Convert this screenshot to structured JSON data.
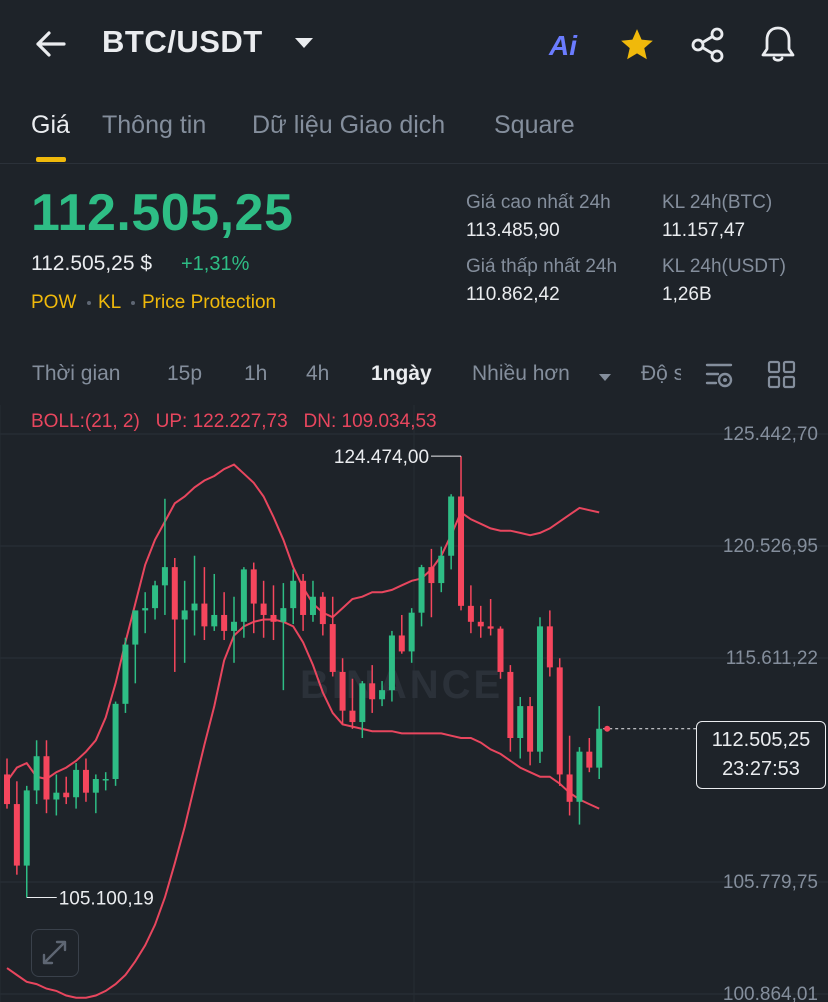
{
  "header": {
    "pair": "BTC/USDT",
    "ai_label": "Ai",
    "icons": [
      "back-arrow-icon",
      "chevron-down-icon",
      "ai-icon",
      "star-icon",
      "share-icon",
      "bell-icon"
    ]
  },
  "tabs": [
    {
      "label": "Giá",
      "active": true
    },
    {
      "label": "Thông tin",
      "active": false
    },
    {
      "label": "Dữ liệu Giao dịch",
      "active": false
    },
    {
      "label": "Square",
      "active": false
    }
  ],
  "price": {
    "last": "112.505,25",
    "usd": "112.505,25 $",
    "change": "+1,31%",
    "tags": [
      "POW",
      "KL",
      "Price Protection"
    ]
  },
  "stats": {
    "high_label": "Giá cao nhất 24h",
    "high_value": "113.485,90",
    "low_label": "Giá thấp nhất 24h",
    "low_value": "110.862,42",
    "vol_btc_label": "KL 24h(BTC)",
    "vol_btc_value": "11.157,47",
    "vol_usdt_label": "KL 24h(USDT)",
    "vol_usdt_value": "1,26B"
  },
  "intervals": {
    "label": "Thời gian",
    "items": [
      "15p",
      "1h",
      "4h",
      "1ngày"
    ],
    "active": "1ngày",
    "more": "Nhiều hơn",
    "depth": "Độ s"
  },
  "boll": {
    "text": "BOLL:(21, 2)",
    "up": "UP: 122.227,73",
    "dn": "DN: 109.034,53"
  },
  "colors": {
    "up": "#2ebd85",
    "down": "#f6465d",
    "accent": "#f0b90b",
    "boll": "#e8465e"
  },
  "watermark": "BINANCE",
  "chart_data": {
    "type": "candlestick",
    "y_axis_labels": [
      "125.442,70",
      "120.526,95",
      "115.611,22",
      "105.779,75",
      "100.864,01"
    ],
    "ylim": [
      100864.01,
      125442.7
    ],
    "max_label": "124.474,00",
    "min_label": "105.100,19",
    "current_price": "112.505,25",
    "countdown": "23:27:53",
    "candles": [
      {
        "o": 110500,
        "h": 111200,
        "l": 109000,
        "c": 109200
      },
      {
        "o": 109200,
        "h": 110200,
        "l": 106100,
        "c": 106500
      },
      {
        "o": 106500,
        "h": 110000,
        "l": 105100,
        "c": 109800
      },
      {
        "o": 109800,
        "h": 112000,
        "l": 109200,
        "c": 111300
      },
      {
        "o": 111300,
        "h": 112000,
        "l": 108800,
        "c": 109400
      },
      {
        "o": 109400,
        "h": 110500,
        "l": 108700,
        "c": 109700
      },
      {
        "o": 109700,
        "h": 110400,
        "l": 109200,
        "c": 109500
      },
      {
        "o": 109500,
        "h": 111000,
        "l": 109000,
        "c": 110700
      },
      {
        "o": 110700,
        "h": 111200,
        "l": 109300,
        "c": 109700
      },
      {
        "o": 109700,
        "h": 110500,
        "l": 108800,
        "c": 110300
      },
      {
        "o": 110300,
        "h": 110600,
        "l": 109800,
        "c": 110300
      },
      {
        "o": 110300,
        "h": 113700,
        "l": 110000,
        "c": 113600
      },
      {
        "o": 113600,
        "h": 116500,
        "l": 113200,
        "c": 116200
      },
      {
        "o": 116200,
        "h": 117700,
        "l": 114500,
        "c": 117700
      },
      {
        "o": 117700,
        "h": 118500,
        "l": 116700,
        "c": 117800
      },
      {
        "o": 117800,
        "h": 119000,
        "l": 117300,
        "c": 118800
      },
      {
        "o": 118800,
        "h": 122600,
        "l": 117500,
        "c": 119600
      },
      {
        "o": 119600,
        "h": 120000,
        "l": 115000,
        "c": 117300
      },
      {
        "o": 117300,
        "h": 119000,
        "l": 115400,
        "c": 117700
      },
      {
        "o": 117700,
        "h": 120100,
        "l": 116600,
        "c": 118000
      },
      {
        "o": 118000,
        "h": 119600,
        "l": 116400,
        "c": 117000
      },
      {
        "o": 117000,
        "h": 119300,
        "l": 116800,
        "c": 117500
      },
      {
        "o": 117500,
        "h": 118500,
        "l": 116400,
        "c": 116800
      },
      {
        "o": 116800,
        "h": 118300,
        "l": 115400,
        "c": 117200
      },
      {
        "o": 117200,
        "h": 119600,
        "l": 116500,
        "c": 119500
      },
      {
        "o": 119500,
        "h": 119800,
        "l": 116700,
        "c": 118000
      },
      {
        "o": 118000,
        "h": 119000,
        "l": 116500,
        "c": 117500
      },
      {
        "o": 117500,
        "h": 118800,
        "l": 116400,
        "c": 117200
      },
      {
        "o": 117200,
        "h": 118900,
        "l": 114200,
        "c": 117800
      },
      {
        "o": 117800,
        "h": 119500,
        "l": 117100,
        "c": 119000
      },
      {
        "o": 119000,
        "h": 119300,
        "l": 116800,
        "c": 117500
      },
      {
        "o": 117500,
        "h": 119000,
        "l": 117200,
        "c": 118300
      },
      {
        "o": 118300,
        "h": 118500,
        "l": 116600,
        "c": 117100
      },
      {
        "o": 117100,
        "h": 118300,
        "l": 114800,
        "c": 115000
      },
      {
        "o": 115000,
        "h": 115600,
        "l": 112700,
        "c": 113300
      },
      {
        "o": 113300,
        "h": 114700,
        "l": 112500,
        "c": 112800
      },
      {
        "o": 112800,
        "h": 114600,
        "l": 112100,
        "c": 114500
      },
      {
        "o": 114500,
        "h": 115300,
        "l": 113200,
        "c": 113800
      },
      {
        "o": 113800,
        "h": 114600,
        "l": 113500,
        "c": 114200
      },
      {
        "o": 114200,
        "h": 116800,
        "l": 113700,
        "c": 116600
      },
      {
        "o": 116600,
        "h": 117500,
        "l": 115800,
        "c": 115900
      },
      {
        "o": 115900,
        "h": 117800,
        "l": 115400,
        "c": 117600
      },
      {
        "o": 117600,
        "h": 119700,
        "l": 117000,
        "c": 119600
      },
      {
        "o": 119600,
        "h": 120400,
        "l": 117400,
        "c": 118900
      },
      {
        "o": 118900,
        "h": 120500,
        "l": 118500,
        "c": 120100
      },
      {
        "o": 120100,
        "h": 122800,
        "l": 119500,
        "c": 122700
      },
      {
        "o": 122700,
        "h": 124474,
        "l": 117700,
        "c": 117900
      },
      {
        "o": 117900,
        "h": 118800,
        "l": 116700,
        "c": 117200
      },
      {
        "o": 117200,
        "h": 117900,
        "l": 116500,
        "c": 117000
      },
      {
        "o": 117000,
        "h": 118200,
        "l": 116600,
        "c": 116900
      },
      {
        "o": 116900,
        "h": 117000,
        "l": 114700,
        "c": 115000
      },
      {
        "o": 115000,
        "h": 115300,
        "l": 111500,
        "c": 112100
      },
      {
        "o": 112100,
        "h": 113900,
        "l": 111200,
        "c": 113500
      },
      {
        "o": 113500,
        "h": 113900,
        "l": 110900,
        "c": 111500
      },
      {
        "o": 111500,
        "h": 117400,
        "l": 111000,
        "c": 117000
      },
      {
        "o": 117000,
        "h": 117700,
        "l": 114800,
        "c": 115200
      },
      {
        "o": 115200,
        "h": 115600,
        "l": 110000,
        "c": 110500
      },
      {
        "o": 110500,
        "h": 112200,
        "l": 108700,
        "c": 109300
      },
      {
        "o": 109300,
        "h": 111700,
        "l": 108300,
        "c": 111500
      },
      {
        "o": 111500,
        "h": 112100,
        "l": 110600,
        "c": 110800
      },
      {
        "o": 110800,
        "h": 113500,
        "l": 110300,
        "c": 112505
      }
    ],
    "boll_upper": [
      110200,
      110800,
      111000,
      110400,
      110300,
      110600,
      110800,
      111100,
      111500,
      112000,
      113000,
      114500,
      116300,
      118000,
      119700,
      120800,
      121600,
      122400,
      122700,
      123100,
      123400,
      123600,
      123900,
      124100,
      123700,
      123300,
      122700,
      121800,
      120800,
      119600,
      118700,
      118000,
      117600,
      117400,
      117800,
      118200,
      118300,
      118500,
      118500,
      118600,
      118800,
      119000,
      119100,
      119500,
      120100,
      121000,
      122000,
      121700,
      121500,
      121300,
      121200,
      121200,
      121100,
      121000,
      121100,
      121300,
      121600,
      121900,
      122200,
      122100,
      122000
    ],
    "boll_lower": [
      102000,
      101700,
      101400,
      101300,
      101100,
      101000,
      100800,
      100700,
      100700,
      100800,
      101000,
      101300,
      101700,
      102300,
      103000,
      103900,
      105100,
      106600,
      108200,
      110000,
      111800,
      113500,
      115500,
      116600,
      117000,
      117200,
      117300,
      117300,
      117200,
      117000,
      116300,
      115300,
      114100,
      113200,
      112700,
      112600,
      112500,
      112400,
      112400,
      112400,
      112300,
      112300,
      112300,
      112300,
      112300,
      112200,
      112100,
      112100,
      111900,
      111600,
      111400,
      111100,
      110800,
      110600,
      110400,
      110400,
      110100,
      109700,
      109400,
      109200,
      109000
    ]
  }
}
